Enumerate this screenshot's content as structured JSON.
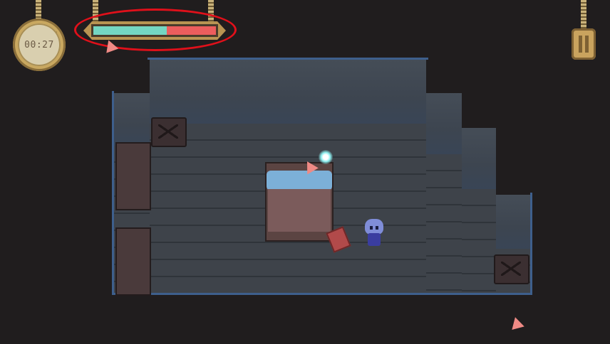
{
  "hud": {
    "timer": {
      "time_text": "00:27"
    },
    "health_bar": {
      "fill_fraction": 0.6,
      "fill_color": "#74d6c2",
      "empty_color": "#ec5d5d",
      "highlighted": true,
      "highlight_color": "#e0101a"
    },
    "pause_button": {
      "icon": "pause-icon"
    }
  },
  "scene": {
    "room": "bedroom",
    "objects": [
      "stool",
      "sofa",
      "sofa",
      "bed",
      "stool",
      "book",
      "wisp",
      "crystal-shard",
      "crystal-shard",
      "crystal-shard"
    ],
    "player": "blue-haired-character"
  }
}
